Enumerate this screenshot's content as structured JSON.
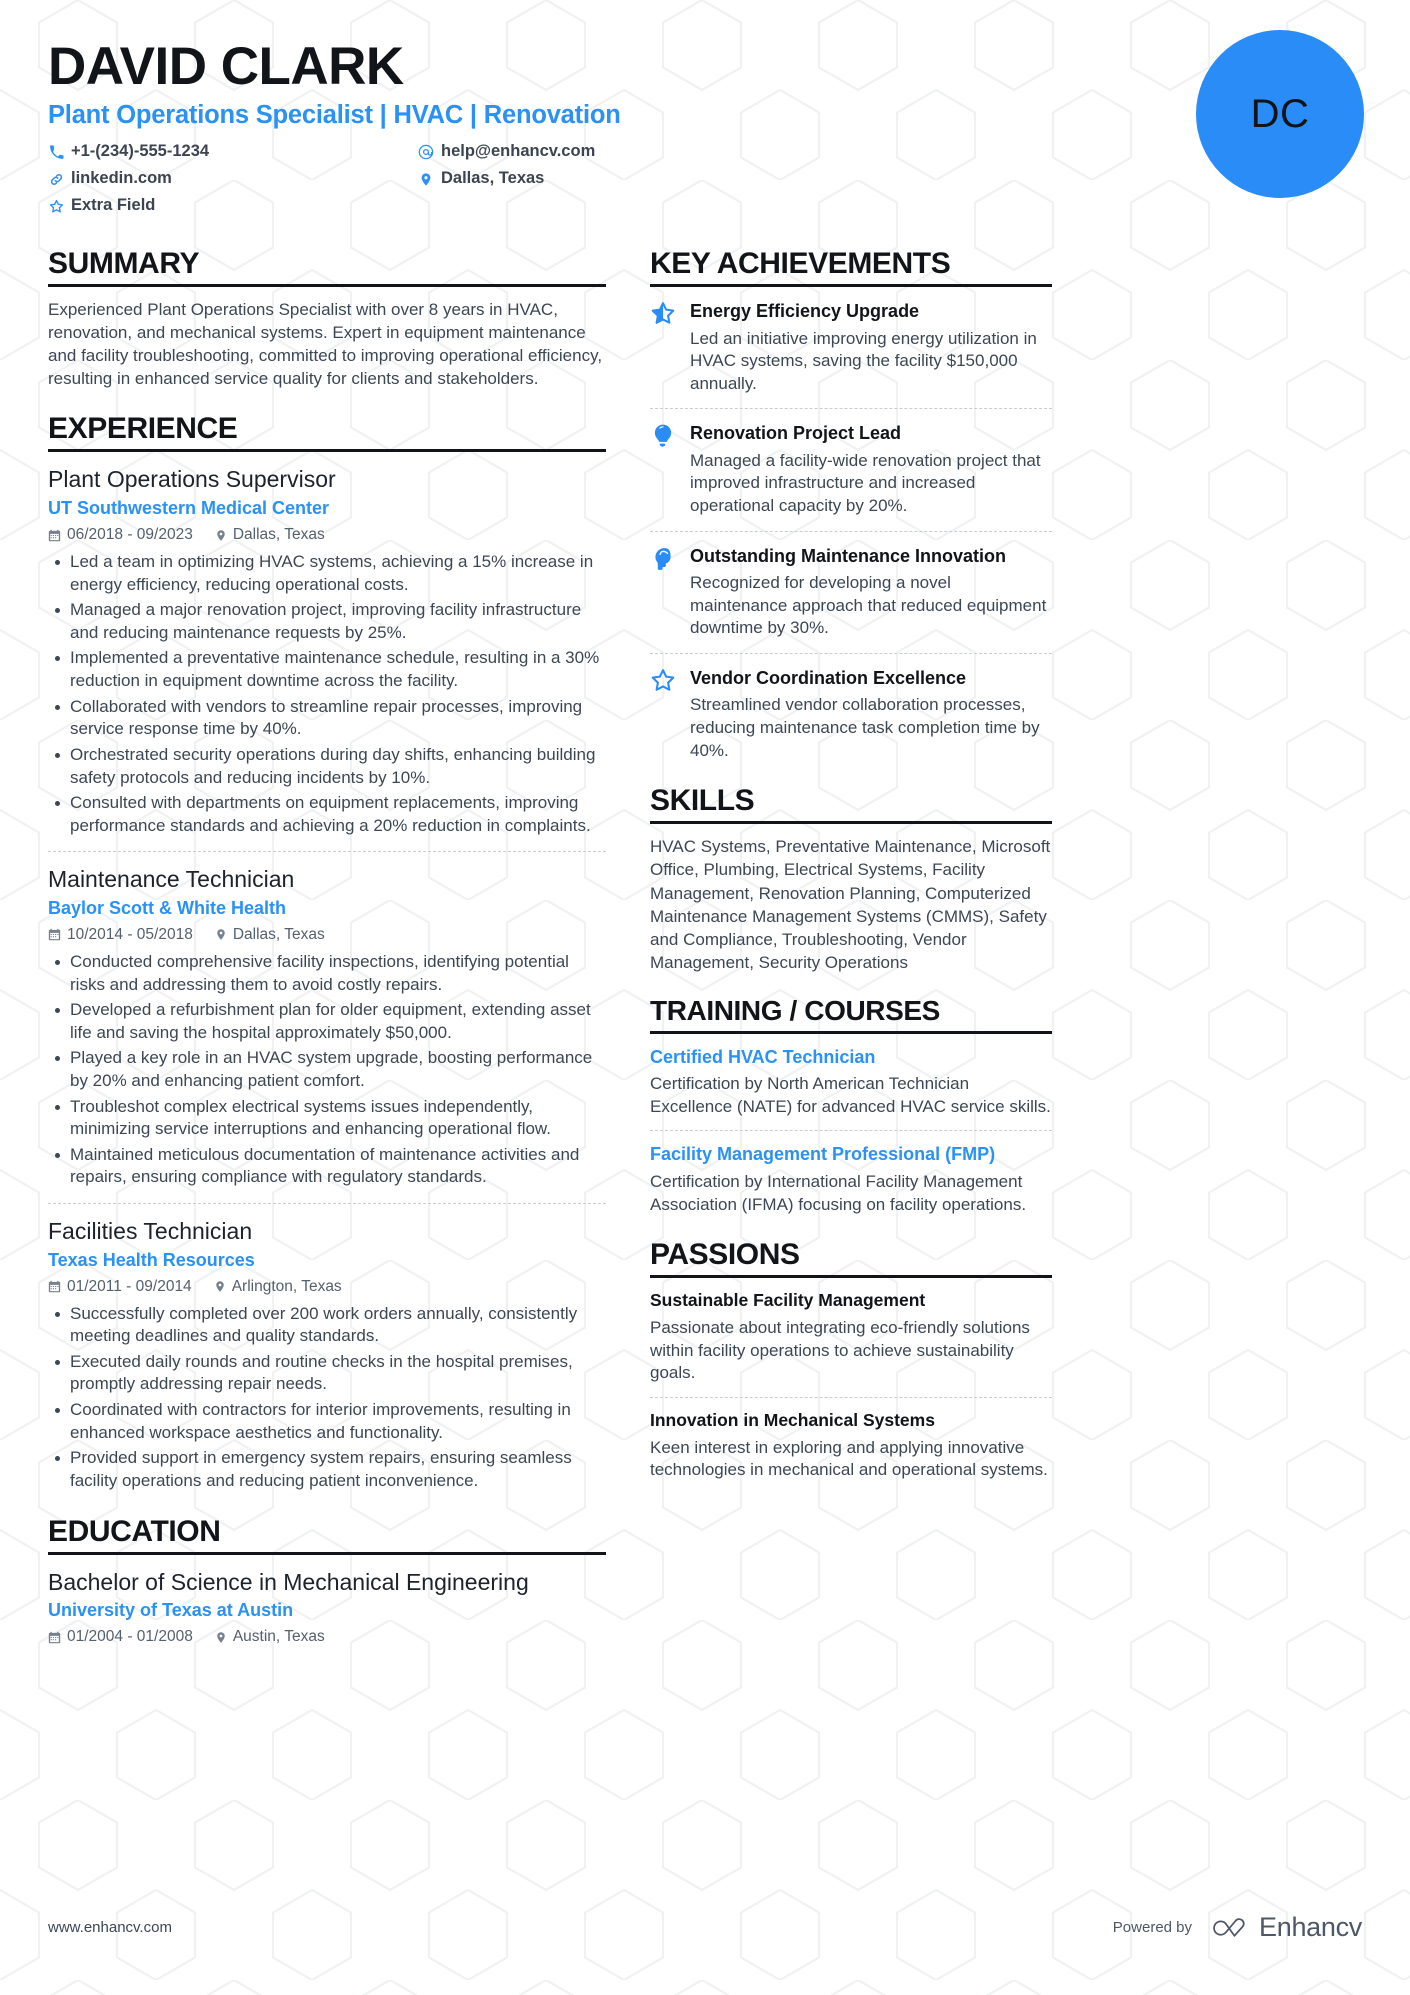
{
  "header": {
    "name": "DAVID CLARK",
    "headline": "Plant Operations Specialist | HVAC | Renovation",
    "avatar_initials": "DC",
    "avatar_color": "#2a8cf7",
    "accent_color": "#2a91f5",
    "contacts_left": [
      {
        "icon": "phone-icon",
        "text": "+1-(234)-555-1234"
      },
      {
        "icon": "link-icon",
        "text": "linkedin.com"
      },
      {
        "icon": "star-icon",
        "text": "Extra Field"
      }
    ],
    "contacts_right": [
      {
        "icon": "email-icon",
        "text": "help@enhancv.com"
      },
      {
        "icon": "location-icon",
        "text": "Dallas, Texas"
      }
    ]
  },
  "summary": {
    "title": "SUMMARY",
    "text": "Experienced Plant Operations Specialist with over 8 years in HVAC, renovation, and mechanical systems. Expert in equipment maintenance and facility troubleshooting, committed to improving operational efficiency, resulting in enhanced service quality for clients and stakeholders."
  },
  "experience": {
    "title": "EXPERIENCE",
    "entries": [
      {
        "role": "Plant Operations Supervisor",
        "org": "UT Southwestern Medical Center",
        "dates": "06/2018 - 09/2023",
        "location": "Dallas, Texas",
        "bullets": [
          "Led a team in optimizing HVAC systems, achieving a 15% increase in energy efficiency, reducing operational costs.",
          "Managed a major renovation project, improving facility infrastructure and reducing maintenance requests by 25%.",
          "Implemented a preventative maintenance schedule, resulting in a 30% reduction in equipment downtime across the facility.",
          "Collaborated with vendors to streamline repair processes, improving service response time by 40%.",
          "Orchestrated security operations during day shifts, enhancing building safety protocols and reducing incidents by 10%.",
          "Consulted with departments on equipment replacements, improving performance standards and achieving a 20% reduction in complaints."
        ]
      },
      {
        "role": "Maintenance Technician",
        "org": "Baylor Scott & White Health",
        "dates": "10/2014 - 05/2018",
        "location": "Dallas, Texas",
        "bullets": [
          "Conducted comprehensive facility inspections, identifying potential risks and addressing them to avoid costly repairs.",
          "Developed a refurbishment plan for older equipment, extending asset life and saving the hospital approximately $50,000.",
          "Played a key role in an HVAC system upgrade, boosting performance by 20% and enhancing patient comfort.",
          "Troubleshot complex electrical systems issues independently, minimizing service interruptions and enhancing operational flow.",
          "Maintained meticulous documentation of maintenance activities and repairs, ensuring compliance with regulatory standards."
        ]
      },
      {
        "role": "Facilities Technician",
        "org": "Texas Health Resources",
        "dates": "01/2011 - 09/2014",
        "location": "Arlington, Texas",
        "bullets": [
          "Successfully completed over 200 work orders annually, consistently meeting deadlines and quality standards.",
          "Executed daily rounds and routine checks in the hospital premises, promptly addressing repair needs.",
          "Coordinated with contractors for interior improvements, resulting in enhanced workspace aesthetics and functionality.",
          "Provided support in emergency system repairs, ensuring seamless facility operations and reducing patient inconvenience."
        ]
      }
    ]
  },
  "education": {
    "title": "EDUCATION",
    "entries": [
      {
        "degree": "Bachelor of Science in Mechanical Engineering",
        "school": "University of Texas at Austin",
        "dates": "01/2004 - 01/2008",
        "location": "Austin, Texas"
      }
    ]
  },
  "achievements": {
    "title": "KEY ACHIEVEMENTS",
    "items": [
      {
        "icon": "half-star-icon",
        "title": "Energy Efficiency Upgrade",
        "desc": "Led an initiative improving energy utilization in HVAC systems, saving the facility $150,000 annually."
      },
      {
        "icon": "lightbulb-icon",
        "title": "Renovation Project Lead",
        "desc": "Managed a facility-wide renovation project that improved infrastructure and increased operational capacity by 20%."
      },
      {
        "icon": "head-profile-icon",
        "title": "Outstanding Maintenance Innovation",
        "desc": "Recognized for developing a novel maintenance approach that reduced equipment downtime by 30%."
      },
      {
        "icon": "outline-star-icon",
        "title": "Vendor Coordination Excellence",
        "desc": "Streamlined vendor collaboration processes, reducing maintenance task completion time by 40%."
      }
    ]
  },
  "skills": {
    "title": "SKILLS",
    "text": "HVAC Systems, Preventative Maintenance, Microsoft Office, Plumbing, Electrical Systems, Facility Management, Renovation Planning, Computerized Maintenance Management Systems (CMMS), Safety and Compliance, Troubleshooting, Vendor Management, Security Operations"
  },
  "training": {
    "title": "TRAINING / COURSES",
    "items": [
      {
        "name": "Certified HVAC Technician",
        "desc": "Certification by North American Technician Excellence (NATE) for advanced HVAC service skills."
      },
      {
        "name": "Facility Management Professional (FMP)",
        "desc": "Certification by International Facility Management Association (IFMA) focusing on facility operations."
      }
    ]
  },
  "passions": {
    "title": "PASSIONS",
    "items": [
      {
        "name": "Sustainable Facility Management",
        "desc": "Passionate about integrating eco-friendly solutions within facility operations to achieve sustainability goals."
      },
      {
        "name": "Innovation in Mechanical Systems",
        "desc": "Keen interest in exploring and applying innovative technologies in mechanical and operational systems."
      }
    ]
  },
  "footer": {
    "url": "www.enhancv.com",
    "powered_by": "Powered by",
    "brand": "Enhancv"
  }
}
